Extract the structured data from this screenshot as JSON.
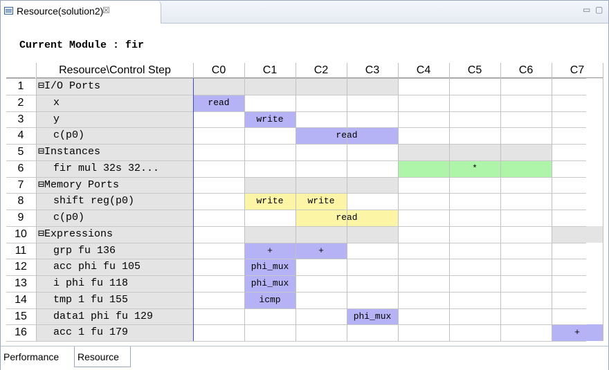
{
  "tab": {
    "title": "Resource(solution2)",
    "close": "☒"
  },
  "window_buttons": {
    "minimize": "▭",
    "maximize": "▢"
  },
  "module_label": "Current Module : fir",
  "columns": {
    "resource": "Resource\\Control Step",
    "steps": [
      "C0",
      "C1",
      "C2",
      "C3",
      "C4",
      "C5",
      "C6",
      "C7"
    ]
  },
  "rows": [
    {
      "num": "1",
      "label": "⊟I/O Ports",
      "group": true
    },
    {
      "num": "2",
      "label": "  x"
    },
    {
      "num": "3",
      "label": "  y"
    },
    {
      "num": "4",
      "label": "  c(p0)"
    },
    {
      "num": "5",
      "label": "⊟Instances",
      "group": true
    },
    {
      "num": "6",
      "label": "  fir mul 32s 32..."
    },
    {
      "num": "7",
      "label": "⊟Memory Ports",
      "group": true
    },
    {
      "num": "8",
      "label": "  shift reg(p0)"
    },
    {
      "num": "9",
      "label": "  c(p0)"
    },
    {
      "num": "10",
      "label": "⊟Expressions",
      "group": true
    },
    {
      "num": "11",
      "label": "  grp fu 136"
    },
    {
      "num": "12",
      "label": "  acc phi fu 105"
    },
    {
      "num": "13",
      "label": "  i phi fu 118"
    },
    {
      "num": "14",
      "label": "  tmp 1 fu 155"
    },
    {
      "num": "15",
      "label": "  data1 phi fu 129"
    },
    {
      "num": "16",
      "label": "  acc 1 fu 179"
    }
  ],
  "group_spans": [
    {
      "row": 0,
      "from": 0,
      "to": 3
    },
    {
      "row": 4,
      "from": 4,
      "to": 6
    },
    {
      "row": 6,
      "from": 1,
      "to": 3
    },
    {
      "row": 9,
      "from": 1,
      "to": 3
    },
    {
      "row": 9,
      "from": 7,
      "to": 7
    }
  ],
  "ops": [
    {
      "row": 1,
      "from": 0,
      "to": 0,
      "text": "read",
      "color": "blue"
    },
    {
      "row": 2,
      "from": 1,
      "to": 1,
      "text": "write",
      "color": "blue"
    },
    {
      "row": 3,
      "from": 2,
      "to": 3,
      "text": "read",
      "color": "blue"
    },
    {
      "row": 5,
      "from": 4,
      "to": 6,
      "text": "*",
      "color": "green"
    },
    {
      "row": 7,
      "from": 1,
      "to": 1,
      "text": "write",
      "color": "yellow"
    },
    {
      "row": 7,
      "from": 2,
      "to": 2,
      "text": "write",
      "color": "yellow"
    },
    {
      "row": 8,
      "from": 2,
      "to": 3,
      "text": "read",
      "color": "yellow"
    },
    {
      "row": 10,
      "from": 1,
      "to": 1,
      "text": "+",
      "color": "blue"
    },
    {
      "row": 10,
      "from": 2,
      "to": 2,
      "text": "+",
      "color": "blue"
    },
    {
      "row": 11,
      "from": 1,
      "to": 1,
      "text": "phi_mux",
      "color": "blue"
    },
    {
      "row": 12,
      "from": 1,
      "to": 1,
      "text": "phi_mux",
      "color": "blue"
    },
    {
      "row": 13,
      "from": 1,
      "to": 1,
      "text": "icmp",
      "color": "blue"
    },
    {
      "row": 14,
      "from": 3,
      "to": 3,
      "text": "phi_mux",
      "color": "blue"
    },
    {
      "row": 15,
      "from": 7,
      "to": 7,
      "text": "+",
      "color": "blue"
    }
  ],
  "bottom_tabs": [
    "Performance",
    "Resource"
  ],
  "colors": {
    "blue": "#b5b3f5",
    "yellow": "#fbf5a5",
    "green": "#aef5a9",
    "group": "#e4e4e4"
  }
}
